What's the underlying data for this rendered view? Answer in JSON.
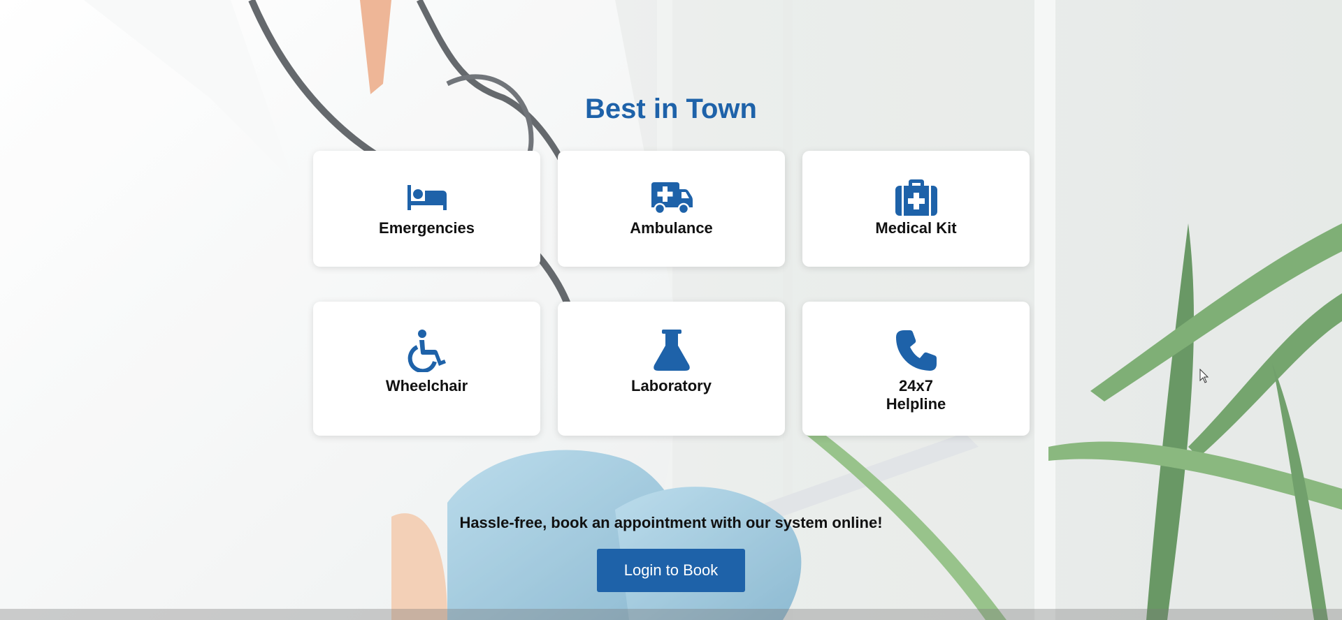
{
  "section": {
    "title": "Best in Town"
  },
  "services": [
    {
      "label": "Emergencies",
      "icon": "bed-icon"
    },
    {
      "label": "Ambulance",
      "icon": "ambulance-icon"
    },
    {
      "label": "Medical Kit",
      "icon": "medical-kit-icon"
    },
    {
      "label": "Wheelchair",
      "icon": "wheelchair-icon"
    },
    {
      "label": "Laboratory",
      "icon": "flask-icon"
    },
    {
      "label": "24x7 Helpline",
      "icon": "phone-icon"
    }
  ],
  "cta": {
    "tagline": "Hassle-free, book an appointment with our system online!",
    "button_label": "Login to Book"
  },
  "colors": {
    "accent": "#1e62a9",
    "card_bg": "#ffffff",
    "text": "#111111"
  }
}
